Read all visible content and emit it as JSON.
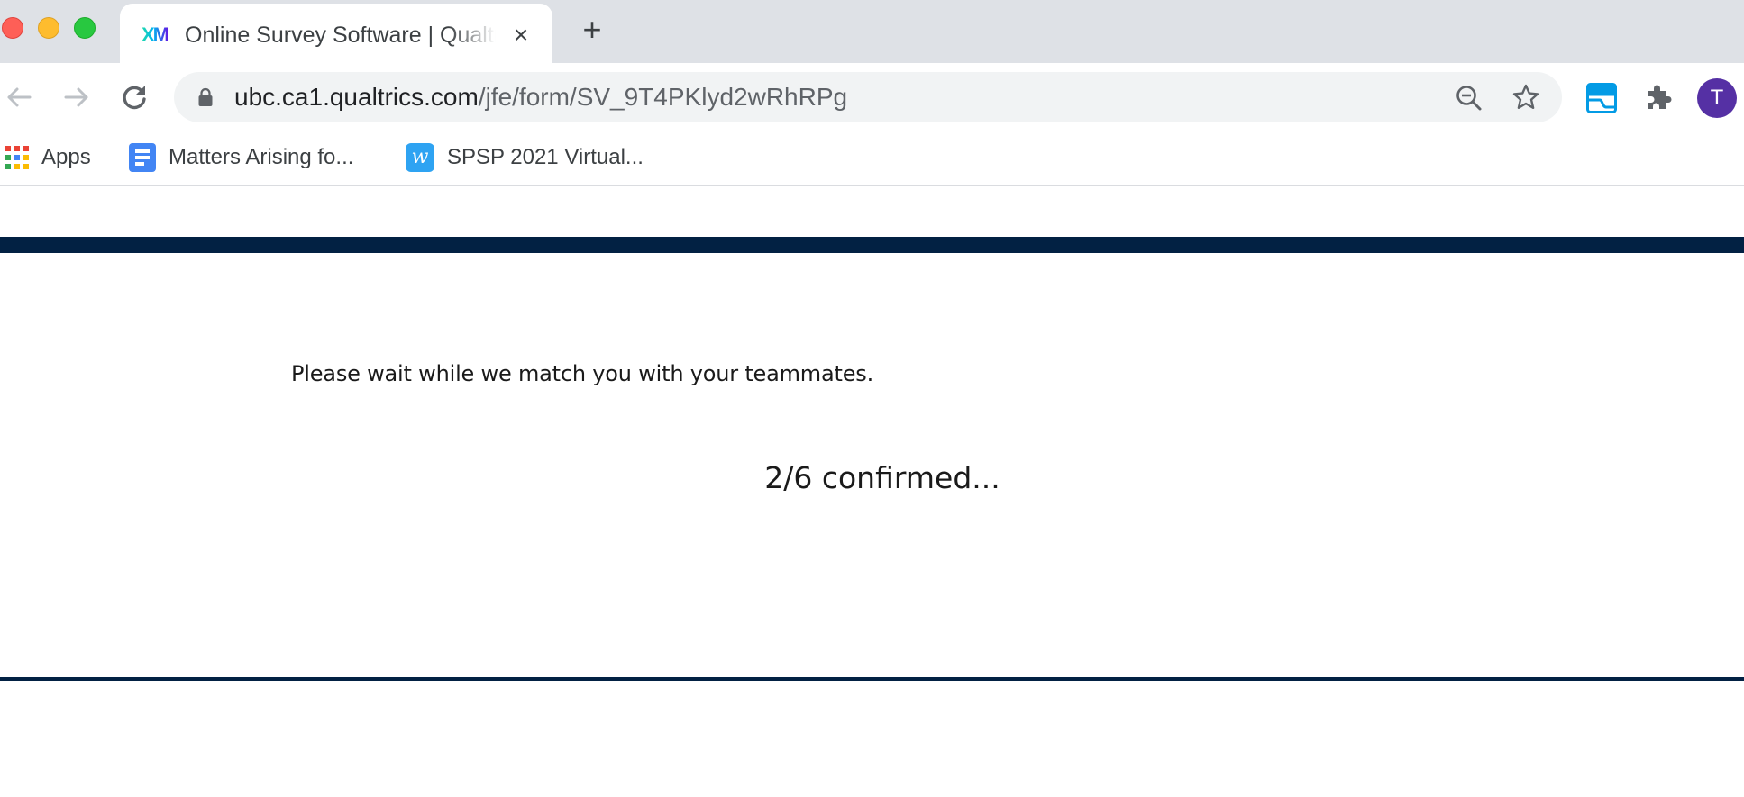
{
  "browser": {
    "window_controls": [
      "close",
      "minimize",
      "maximize"
    ],
    "tab": {
      "favicon": "XM",
      "title": "Online Survey Software | Qualtrics Survey Solutions",
      "close_icon": "×"
    },
    "new_tab_icon": "+",
    "address_bar": {
      "host": "ubc.ca1.qualtrics.com",
      "path": "/jfe/form/SV_9T4PKlyd2wRhRPg"
    },
    "profile_initial": "T",
    "colors": {
      "avatar": "#5530a4",
      "tab_strip": "#dee1e6",
      "omnibox": "#f1f3f4"
    }
  },
  "bookmarks": [
    {
      "label": "Apps",
      "icon": "apps-grid-icon"
    },
    {
      "label": "Matters Arising fo...",
      "icon": "google-docs-icon"
    },
    {
      "label": "SPSP 2021 Virtual...",
      "icon": "w-app-icon"
    }
  ],
  "survey": {
    "instruction": "Please wait while we match you with your teammates.",
    "status": "2/6 confirmed...",
    "confirmed_count": 2,
    "total_count": 6,
    "colors": {
      "header_bar": "#022143",
      "text": "#1a1a1a"
    }
  }
}
